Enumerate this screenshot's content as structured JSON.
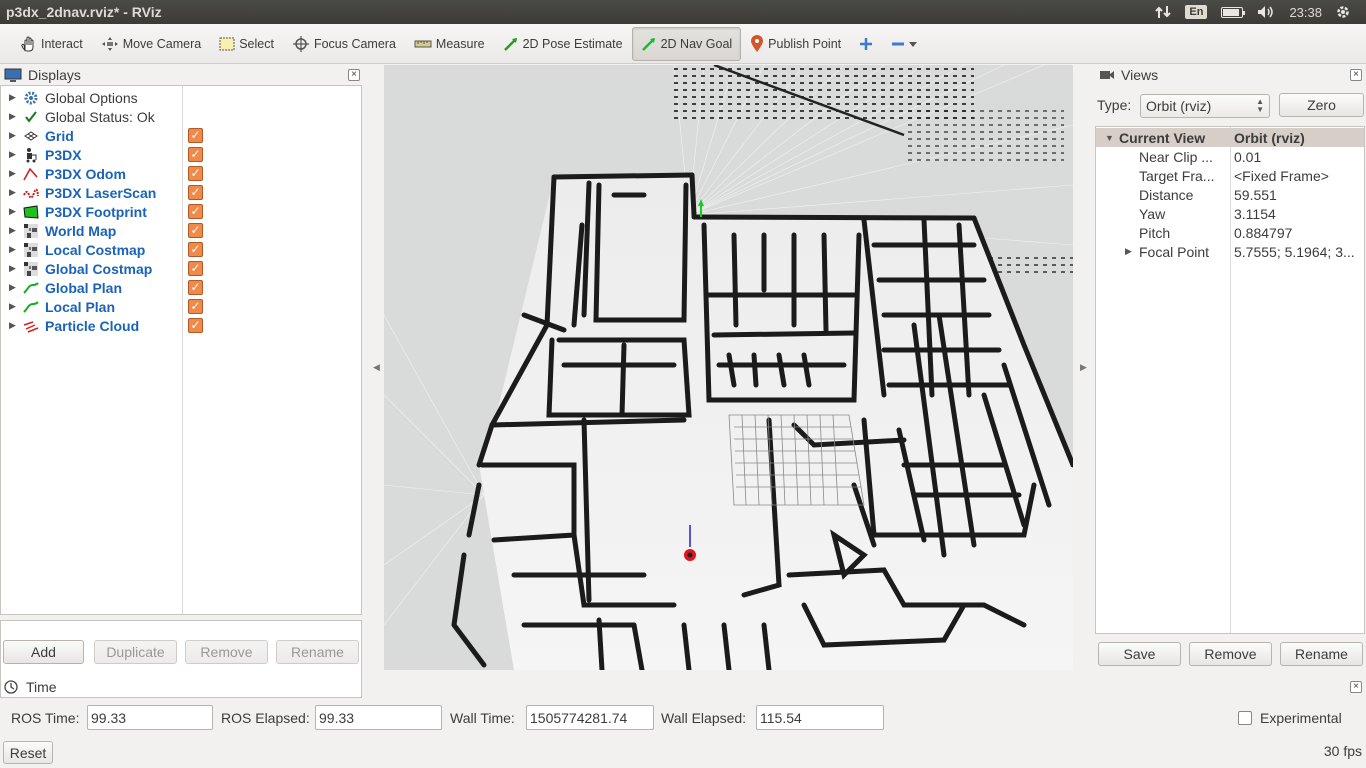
{
  "window": {
    "title": "p3dx_2dnav.rviz* - RViz"
  },
  "tray": {
    "lang": "En",
    "time": "23:38",
    "battery_level": 0.85
  },
  "toolbar": {
    "tools": [
      {
        "label": "Interact",
        "icon": "hand-icon"
      },
      {
        "label": "Move Camera",
        "icon": "move-camera-icon"
      },
      {
        "label": "Select",
        "icon": "select-icon"
      },
      {
        "label": "Focus Camera",
        "icon": "focus-camera-icon"
      },
      {
        "label": "Measure",
        "icon": "measure-icon"
      },
      {
        "label": "2D Pose Estimate",
        "icon": "pose-estimate-icon"
      },
      {
        "label": "2D Nav Goal",
        "icon": "nav-goal-icon",
        "active": true
      },
      {
        "label": "Publish Point",
        "icon": "map-pin-icon"
      }
    ]
  },
  "displays": {
    "title": "Displays",
    "items": [
      {
        "label": "Global Options",
        "icon": "gear-icon",
        "style": "plain",
        "checked": null
      },
      {
        "label": "Global Status: Ok",
        "icon": "checkmark-icon",
        "style": "plain",
        "checked": null
      },
      {
        "label": "Grid",
        "icon": "grid-icon",
        "style": "blue",
        "checked": true
      },
      {
        "label": "P3DX",
        "icon": "robot-model-icon",
        "style": "blue",
        "checked": true
      },
      {
        "label": "P3DX Odom",
        "icon": "odometry-icon",
        "style": "blue",
        "checked": true
      },
      {
        "label": "P3DX LaserScan",
        "icon": "laserscan-icon",
        "style": "blue",
        "checked": true
      },
      {
        "label": "P3DX Footprint",
        "icon": "polygon-icon",
        "style": "blue",
        "checked": true
      },
      {
        "label": "World Map",
        "icon": "map-icon",
        "style": "blue",
        "checked": true
      },
      {
        "label": "Local Costmap",
        "icon": "map-icon",
        "style": "blue",
        "checked": true
      },
      {
        "label": "Global Costmap",
        "icon": "map-icon",
        "style": "blue",
        "checked": true
      },
      {
        "label": "Global Plan",
        "icon": "path-icon",
        "style": "blue",
        "checked": true
      },
      {
        "label": "Local Plan",
        "icon": "path-icon",
        "style": "blue",
        "checked": true
      },
      {
        "label": "Particle Cloud",
        "icon": "pose-array-icon",
        "style": "blue",
        "checked": true
      }
    ],
    "buttons": {
      "add": "Add",
      "duplicate": "Duplicate",
      "remove": "Remove",
      "rename": "Rename"
    }
  },
  "views": {
    "title": "Views",
    "type_label": "Type:",
    "type_value": "Orbit (rviz)",
    "zero": "Zero",
    "current_view": {
      "key": "Current View",
      "value": "Orbit (rviz)"
    },
    "props": [
      {
        "key": "Near Clip ...",
        "value": "0.01"
      },
      {
        "key": "Target Fra...",
        "value": "<Fixed Frame>"
      },
      {
        "key": "Distance",
        "value": "59.551"
      },
      {
        "key": "Yaw",
        "value": "3.1154"
      },
      {
        "key": "Pitch",
        "value": "0.884797"
      },
      {
        "key": "Focal Point",
        "value": "5.7555; 5.1964; 3...",
        "expandable": true
      }
    ],
    "buttons": {
      "save": "Save",
      "remove": "Remove",
      "rename": "Rename"
    }
  },
  "time": {
    "title": "Time",
    "ros_time_label": "ROS Time:",
    "ros_time": "99.33",
    "ros_elapsed_label": "ROS Elapsed:",
    "ros_elapsed": "99.33",
    "wall_time_label": "Wall Time:",
    "wall_time": "1505774281.74",
    "wall_elapsed_label": "Wall Elapsed:",
    "wall_elapsed": "115.54",
    "experimental_label": "Experimental",
    "reset": "Reset",
    "fps": "30 fps"
  },
  "colors": {
    "accent_blue": "#1a63b7",
    "checkbox_orange": "#f08a4b",
    "robot_red": "#e0141e"
  }
}
